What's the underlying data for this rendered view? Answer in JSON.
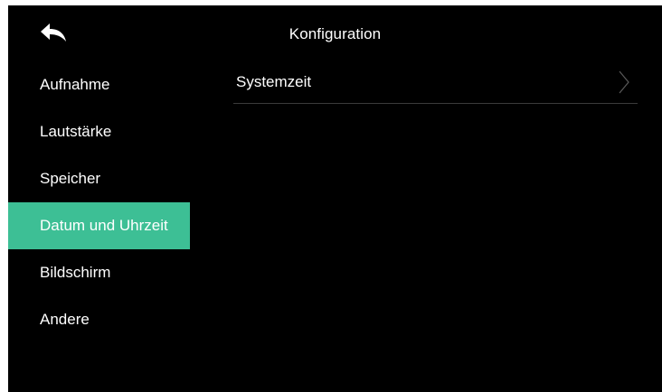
{
  "colors": {
    "accent": "#3dbf95",
    "background": "#000000",
    "text": "#ffffff",
    "divider": "#3a3a3a"
  },
  "header": {
    "title": "Konfiguration",
    "back_icon": "back-arrow-icon"
  },
  "sidebar": {
    "items": [
      {
        "label": "Aufnahme",
        "active": false
      },
      {
        "label": "Lautstärke",
        "active": false
      },
      {
        "label": "Speicher",
        "active": false
      },
      {
        "label": "Datum und Uhrzeit",
        "active": true
      },
      {
        "label": "Bildschirm",
        "active": false
      },
      {
        "label": "Andere",
        "active": false
      }
    ]
  },
  "main": {
    "rows": [
      {
        "label": "Systemzeit",
        "icon": "chevron-right-icon"
      }
    ]
  }
}
